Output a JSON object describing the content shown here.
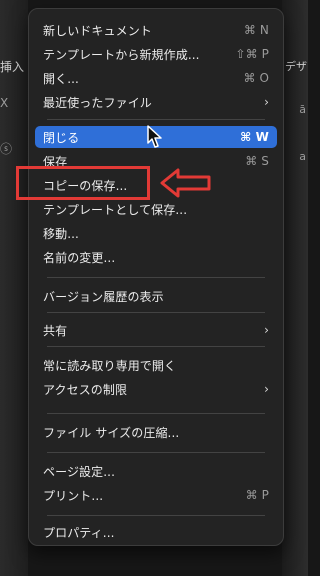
{
  "background": {
    "left_label": "挿入",
    "right_label": "デザ",
    "left_marks": [
      "X",
      "ⓢ"
    ],
    "right_marks": [
      "ā",
      "a"
    ]
  },
  "menu": {
    "items": [
      {
        "label": "新しいドキュメント",
        "shortcut": "⌘ N"
      },
      {
        "label": "テンプレートから新規作成...",
        "shortcut": "⇧⌘ P"
      },
      {
        "label": "開く...",
        "shortcut": "⌘ O"
      },
      {
        "label": "最近使ったファイル",
        "shortcut": "",
        "submenu": true
      },
      {
        "label": "閉じる",
        "shortcut": "⌘ W",
        "highlighted": true
      },
      {
        "label": "保存",
        "shortcut": "⌘ S"
      },
      {
        "label": "コピーの保存...",
        "shortcut": ""
      },
      {
        "label": "テンプレートとして保存...",
        "shortcut": ""
      },
      {
        "label": "移動...",
        "shortcut": ""
      },
      {
        "label": "名前の変更...",
        "shortcut": ""
      },
      {
        "label": "バージョン履歴の表示",
        "shortcut": ""
      },
      {
        "label": "共有",
        "shortcut": "",
        "submenu": true
      },
      {
        "label": "常に読み取り専用で開く",
        "shortcut": ""
      },
      {
        "label": "アクセスの制限",
        "shortcut": "",
        "submenu": true
      },
      {
        "label": "ファイル サイズの圧縮...",
        "shortcut": ""
      },
      {
        "label": "ページ設定...",
        "shortcut": ""
      },
      {
        "label": "プリント...",
        "shortcut": "⌘ P"
      },
      {
        "label": "プロパティ...",
        "shortcut": ""
      }
    ],
    "submenu_indicator": "›"
  },
  "annotation": {
    "color": "#e23a36"
  },
  "colors": {
    "menu_bg": "#232323",
    "highlight": "#2f6fd8",
    "text": "#ececec",
    "shortcut": "#9a9a9a"
  }
}
